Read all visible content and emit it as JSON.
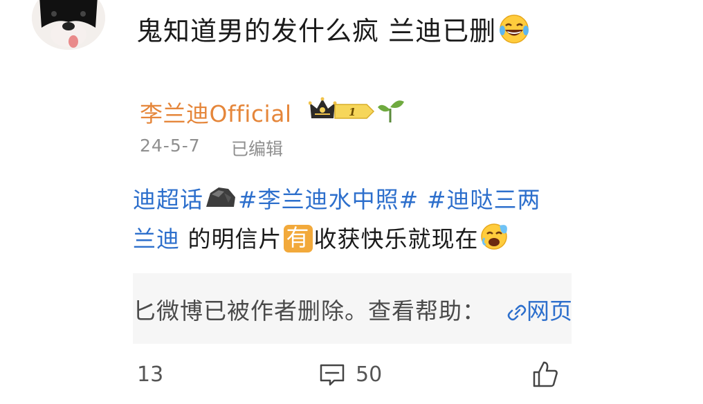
{
  "comment": {
    "text": "鬼知道男的发什么疯 兰迪已删"
  },
  "post": {
    "author": "李兰迪Official",
    "badge_level": "1",
    "date": "24-5-7",
    "edited": "已编辑",
    "topic": "迪超话",
    "hashtag1": "#李兰迪水中照#",
    "hashtag2": "#迪哒三两",
    "line2_link": "兰迪",
    "line2_text_a": " 的明信片",
    "chip": "有",
    "line2_text_b": "收获快乐就现在",
    "deleted_notice": "匕微博已被作者删除。查看帮助：",
    "web_link": "网页"
  },
  "actions": {
    "reposts": "13",
    "comments": "50"
  },
  "colors": {
    "author": "#e5863a",
    "link": "#2d6fcc",
    "chip": "#f2a93b",
    "deleted_bg": "#f6f6f6"
  },
  "icons": [
    "avatar-image",
    "laughing-tears-icon",
    "crown-badge-icon",
    "level-badge-icon",
    "sprout-icon",
    "rock-icon",
    "crying-emoji-icon",
    "link-icon",
    "comment-icon",
    "like-icon"
  ]
}
